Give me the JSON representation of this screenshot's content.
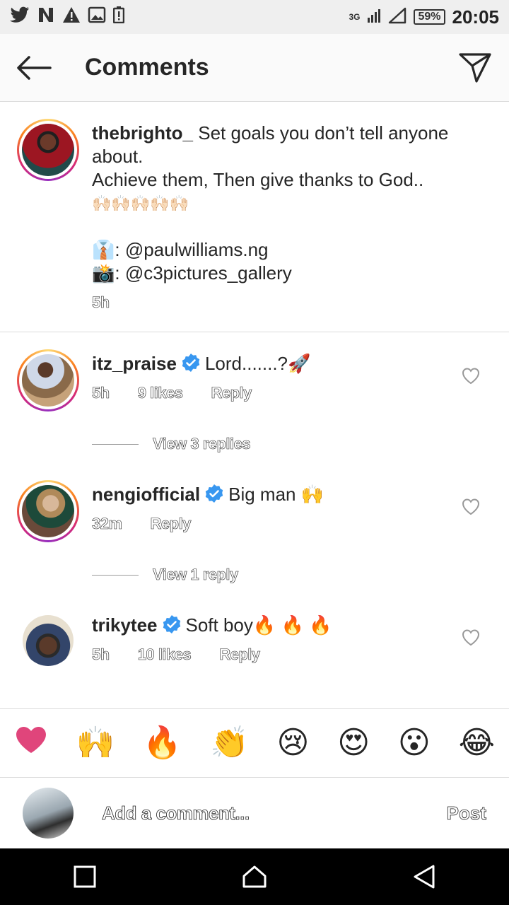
{
  "status_bar": {
    "network": "3G",
    "battery": "59%",
    "time": "20:05"
  },
  "header": {
    "title": "Comments"
  },
  "caption": {
    "username": "thebrighto_",
    "line1": "Set goals you don’t tell anyone about.",
    "line2": "Achieve them, Then give thanks to God..",
    "emojis": "🙌🏻🙌🏻🙌🏻🙌🏻🙌🏻",
    "credit1_emoji": "👔",
    "credit1": ": @paulwilliams.ng",
    "credit2_emoji": "📸",
    "credit2": ": @c3pictures_gallery",
    "time": "5h"
  },
  "comments": [
    {
      "username": "itz_praise",
      "text": "Lord.......?🚀",
      "time": "5h",
      "likes": "9 likes",
      "reply": "Reply",
      "view_replies": "View 3 replies"
    },
    {
      "username": "nengiofficial",
      "text": "Big man 🙌",
      "time": "32m",
      "reply": "Reply",
      "view_replies": "View 1 reply"
    },
    {
      "username": "trikytee",
      "text": "Soft boy🔥 🔥 🔥",
      "time": "5h",
      "likes": "10 likes",
      "reply": "Reply"
    }
  ],
  "reactions": [
    "❤",
    "🙌",
    "🔥",
    "👏",
    "😢",
    "😍",
    "😮",
    "😂"
  ],
  "composer": {
    "placeholder": "Add a comment...",
    "post_label": "Post"
  },
  "colors": {
    "verified": "#3897f0",
    "heart": "#e0457b",
    "ring_start": "#feda75",
    "ring_end": "#962fbf"
  }
}
